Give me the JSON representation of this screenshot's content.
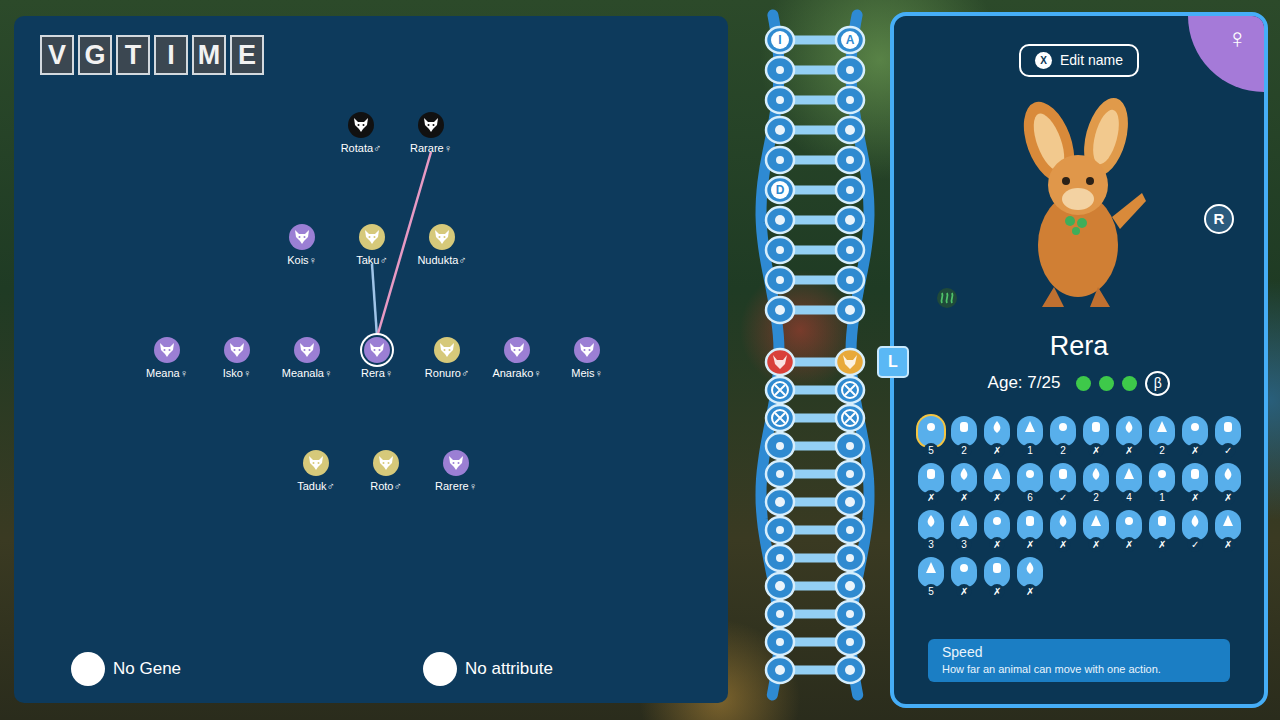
{
  "watermark": [
    "V",
    "G",
    "T",
    "I",
    "M",
    "E"
  ],
  "family_tree": {
    "generations": [
      [
        {
          "name": "Rotata",
          "sex": "♂",
          "color": "#111111",
          "selected": false
        },
        {
          "name": "Rarare",
          "sex": "♀",
          "color": "#111111",
          "selected": false
        }
      ],
      [
        {
          "name": "Kois",
          "sex": "♀",
          "color": "#9b7fd4",
          "selected": false
        },
        {
          "name": "Taku",
          "sex": "♂",
          "color": "#d6c97a",
          "selected": false
        },
        {
          "name": "Nudukta",
          "sex": "♂",
          "color": "#d6c97a",
          "selected": false
        }
      ],
      [
        {
          "name": "Meana",
          "sex": "♀",
          "color": "#9b7fd4",
          "selected": false
        },
        {
          "name": "Isko",
          "sex": "♀",
          "color": "#9b7fd4",
          "selected": false
        },
        {
          "name": "Meanala",
          "sex": "♀",
          "color": "#9b7fd4",
          "selected": false
        },
        {
          "name": "Rera",
          "sex": "♀",
          "color": "#9b7fd4",
          "selected": true
        },
        {
          "name": "Ronuro",
          "sex": "♂",
          "color": "#d6c97a",
          "selected": false
        },
        {
          "name": "Anarako",
          "sex": "♀",
          "color": "#9b7fd4",
          "selected": false
        },
        {
          "name": "Meis",
          "sex": "♀",
          "color": "#9b7fd4",
          "selected": false
        }
      ],
      [
        {
          "name": "Taduk",
          "sex": "♂",
          "color": "#d6c97a",
          "selected": false
        },
        {
          "name": "Roto",
          "sex": "♂",
          "color": "#d6c97a",
          "selected": false
        },
        {
          "name": "Rarere",
          "sex": "♀",
          "color": "#9b7fd4",
          "selected": false
        }
      ]
    ],
    "links": [
      {
        "from": "Taku",
        "to": "Rera",
        "color": "#9fc4e8"
      },
      {
        "from": "Rarare",
        "to": "Rera",
        "color": "#e79ac4"
      }
    ]
  },
  "legend": [
    {
      "label": "No Gene"
    },
    {
      "label": "No attribute"
    }
  ],
  "dna": {
    "rungs": [
      {
        "left": "I",
        "right": "A",
        "crossed": false
      },
      {
        "left": "",
        "right": "",
        "crossed": false
      },
      {
        "left": "",
        "right": "",
        "crossed": false
      },
      {
        "left": "",
        "right": "",
        "crossed": false
      },
      {
        "left": "",
        "right": "",
        "crossed": false
      },
      {
        "left": "D",
        "right": "",
        "crossed": false
      },
      {
        "left": "",
        "right": "",
        "crossed": false
      },
      {
        "left": "",
        "right": "",
        "crossed": false
      },
      {
        "left": "",
        "right": "",
        "crossed": false
      },
      {
        "left": "",
        "right": "",
        "crossed": false
      },
      {
        "left": "",
        "right": "",
        "crossed": false,
        "color_left": "#d9403a",
        "color_right": "#e8a93a"
      },
      {
        "left": "",
        "right": "",
        "crossed": true
      },
      {
        "left": "",
        "right": "",
        "crossed": true
      },
      {
        "left": "",
        "right": "",
        "crossed": false
      },
      {
        "left": "",
        "right": "",
        "crossed": false
      },
      {
        "left": "",
        "right": "",
        "crossed": false
      },
      {
        "left": "",
        "right": "",
        "crossed": false
      },
      {
        "left": "",
        "right": "",
        "crossed": false
      },
      {
        "left": "",
        "right": "",
        "crossed": false
      },
      {
        "left": "",
        "right": "",
        "crossed": false
      },
      {
        "left": "",
        "right": "",
        "crossed": false
      },
      {
        "left": "",
        "right": "",
        "crossed": false
      }
    ]
  },
  "side_key": "L",
  "profile": {
    "sex": "♀",
    "edit_button": {
      "key": "X",
      "label": "Edit name"
    },
    "rank": "R",
    "name": "Rera",
    "age": "Age: 7/25",
    "health": [
      {
        "filled": true
      },
      {
        "filled": true
      },
      {
        "filled": true
      }
    ],
    "beta": "β",
    "genes": [
      [
        {
          "value": "5",
          "selected": true
        },
        {
          "value": "2",
          "selected": false
        },
        {
          "value": "✗",
          "selected": false
        },
        {
          "value": "1",
          "selected": false
        },
        {
          "value": "2",
          "selected": false
        },
        {
          "value": "✗",
          "selected": false
        },
        {
          "value": "✗",
          "selected": false
        },
        {
          "value": "2",
          "selected": false
        },
        {
          "value": "✗",
          "selected": false
        },
        {
          "value": "✓",
          "selected": false
        }
      ],
      [
        {
          "value": "✗",
          "selected": false
        },
        {
          "value": "✗",
          "selected": false
        },
        {
          "value": "✗",
          "selected": false
        },
        {
          "value": "6",
          "selected": false
        },
        {
          "value": "✓",
          "selected": false
        },
        {
          "value": "2",
          "selected": false
        },
        {
          "value": "4",
          "selected": false
        },
        {
          "value": "1",
          "selected": false
        },
        {
          "value": "✗",
          "selected": false
        },
        {
          "value": "✗",
          "selected": false
        }
      ],
      [
        {
          "value": "3",
          "selected": false
        },
        {
          "value": "3",
          "selected": false
        },
        {
          "value": "✗",
          "selected": false
        },
        {
          "value": "✗",
          "selected": false
        },
        {
          "value": "✗",
          "selected": false
        },
        {
          "value": "✗",
          "selected": false
        },
        {
          "value": "✗",
          "selected": false
        },
        {
          "value": "✗",
          "selected": false
        },
        {
          "value": "✓",
          "selected": false
        },
        {
          "value": "✗",
          "selected": false
        }
      ],
      [
        {
          "value": "5",
          "selected": false
        },
        {
          "value": "✗",
          "selected": false
        },
        {
          "value": "✗",
          "selected": false
        },
        {
          "value": "✗",
          "selected": false
        }
      ]
    ],
    "tooltip": {
      "title": "Speed",
      "text": "How far an animal can move with one action."
    }
  }
}
